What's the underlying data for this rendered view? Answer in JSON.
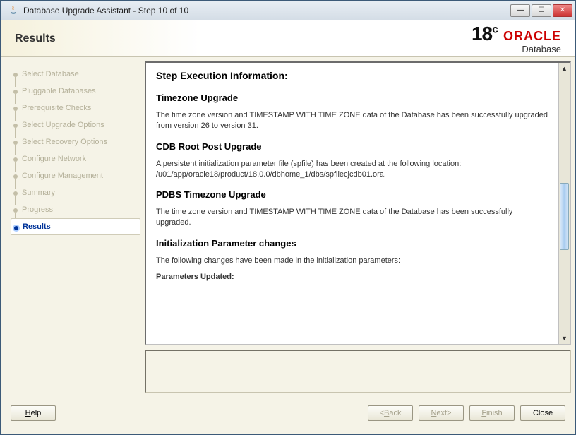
{
  "window": {
    "title": "Database Upgrade Assistant - Step 10 of 10"
  },
  "header": {
    "page_title": "Results",
    "version": "18",
    "version_suffix": "c",
    "brand": "ORACLE",
    "product": "Database"
  },
  "steps": [
    {
      "label": "Select Database",
      "state": "past"
    },
    {
      "label": "Pluggable Databases",
      "state": "past"
    },
    {
      "label": "Prerequisite Checks",
      "state": "past"
    },
    {
      "label": "Select Upgrade Options",
      "state": "past"
    },
    {
      "label": "Select Recovery Options",
      "state": "past"
    },
    {
      "label": "Configure Network",
      "state": "past"
    },
    {
      "label": "Configure Management",
      "state": "past"
    },
    {
      "label": "Summary",
      "state": "past"
    },
    {
      "label": "Progress",
      "state": "past"
    },
    {
      "label": "Results",
      "state": "current"
    }
  ],
  "content": {
    "title": "Step Execution Information:",
    "sections": [
      {
        "heading": "Timezone Upgrade",
        "body": "The time zone version and TIMESTAMP WITH TIME ZONE data of the Database has been successfully upgraded from version 26 to version 31."
      },
      {
        "heading": "CDB Root Post Upgrade",
        "body": "A persistent initialization parameter file (spfile) has been created at the following location: /u01/app/oracle18/product/18.0.0/dbhome_1/dbs/spfilecjcdb01.ora."
      },
      {
        "heading": "PDBS Timezone Upgrade",
        "body": "The time zone version and TIMESTAMP WITH TIME ZONE data of the Database has been successfully upgraded."
      },
      {
        "heading": "Initialization Parameter changes",
        "body": "The following changes have been made in the initialization parameters:"
      }
    ],
    "subheading": "Parameters Updated:"
  },
  "footer": {
    "help": "Help",
    "back": "Back",
    "next": "Next",
    "finish": "Finish",
    "close": "Close"
  }
}
